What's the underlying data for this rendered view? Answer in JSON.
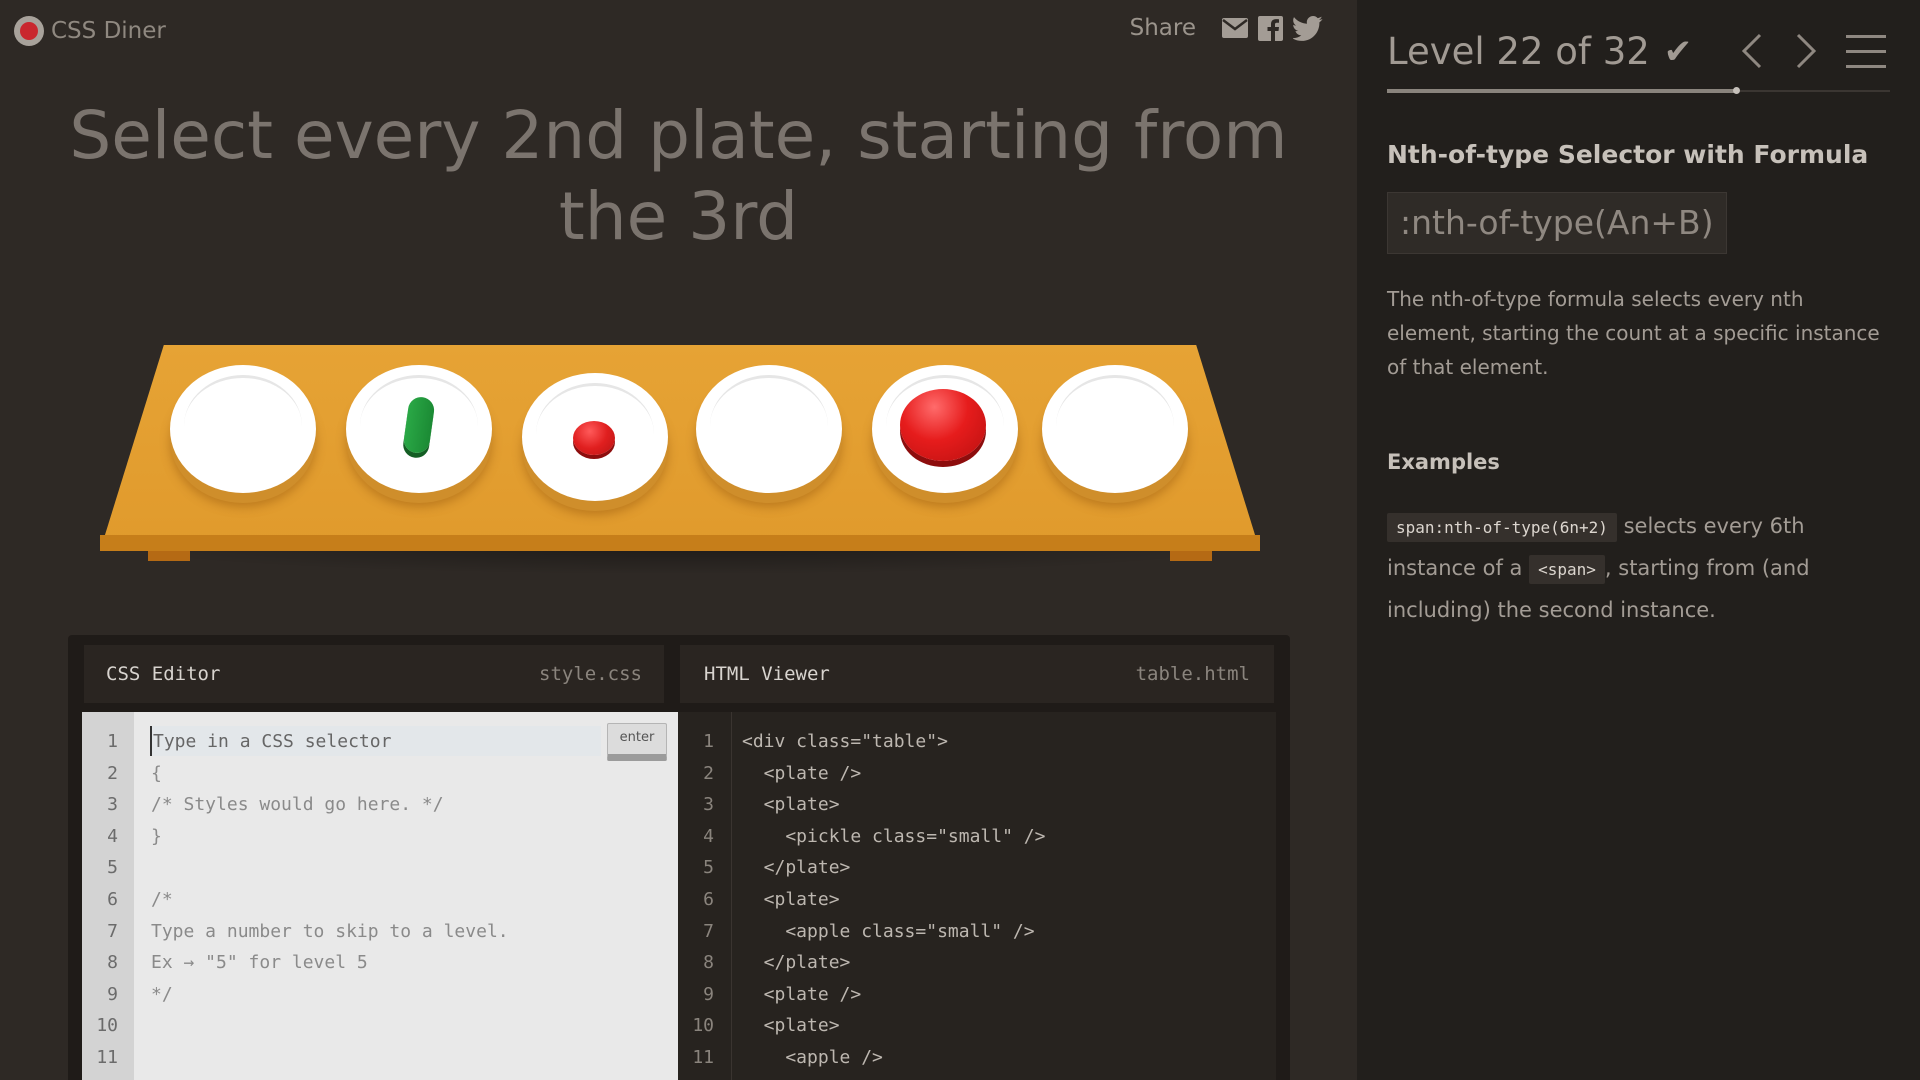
{
  "app": {
    "logo_text": "CSS Diner",
    "share_label": "Share",
    "share_icons": [
      "envelope-icon",
      "facebook-icon",
      "twitter-icon"
    ]
  },
  "instruction": "Select every 2nd plate, starting from the 3rd",
  "table": {
    "plates": [
      {
        "contents": "empty"
      },
      {
        "contents": "pickle",
        "class": "small"
      },
      {
        "contents": "apple",
        "class": "small"
      },
      {
        "contents": "empty"
      },
      {
        "contents": "apple"
      },
      {
        "contents": "empty"
      }
    ]
  },
  "css_editor": {
    "title": "CSS Editor",
    "file": "style.css",
    "input_placeholder": "Type in a CSS selector",
    "enter_label": "enter",
    "line_numbers": [
      "1",
      "2",
      "3",
      "4",
      "5",
      "6",
      "7",
      "8",
      "9",
      "10",
      "11"
    ],
    "lines": [
      "",
      "{",
      "/* Styles would go here. */",
      "}",
      "",
      "/*",
      "Type a number to skip to a level.",
      "Ex → \"5\" for level 5",
      "*/",
      "",
      ""
    ]
  },
  "html_viewer": {
    "title": "HTML Viewer",
    "file": "table.html",
    "line_numbers": [
      "1",
      "2",
      "3",
      "4",
      "5",
      "6",
      "7",
      "8",
      "9",
      "10",
      "11"
    ],
    "lines": [
      "<div class=\"table\">",
      "  <plate />",
      "  <plate>",
      "    <pickle class=\"small\" />",
      "  </plate>",
      "  <plate>",
      "    <apple class=\"small\" />",
      "  </plate>",
      "  <plate />",
      "  <plate>",
      "    <apple />"
    ]
  },
  "sidebar": {
    "level_text": "Level 22 of 32",
    "level_completed": true,
    "progress": 0.6875,
    "selector_name": "Nth-of-type Selector with Formula",
    "syntax": ":nth-of-type(An+B)",
    "description": "The nth-of-type formula selects every nth element, starting the count at a specific instance of that element.",
    "examples_title": "Examples",
    "example": {
      "code": "span:nth-of-type(6n+2)",
      "text_1": " selects every 6th instance of a ",
      "code_2": "<span>",
      "text_2": ", starting from (and including) the second instance."
    }
  }
}
